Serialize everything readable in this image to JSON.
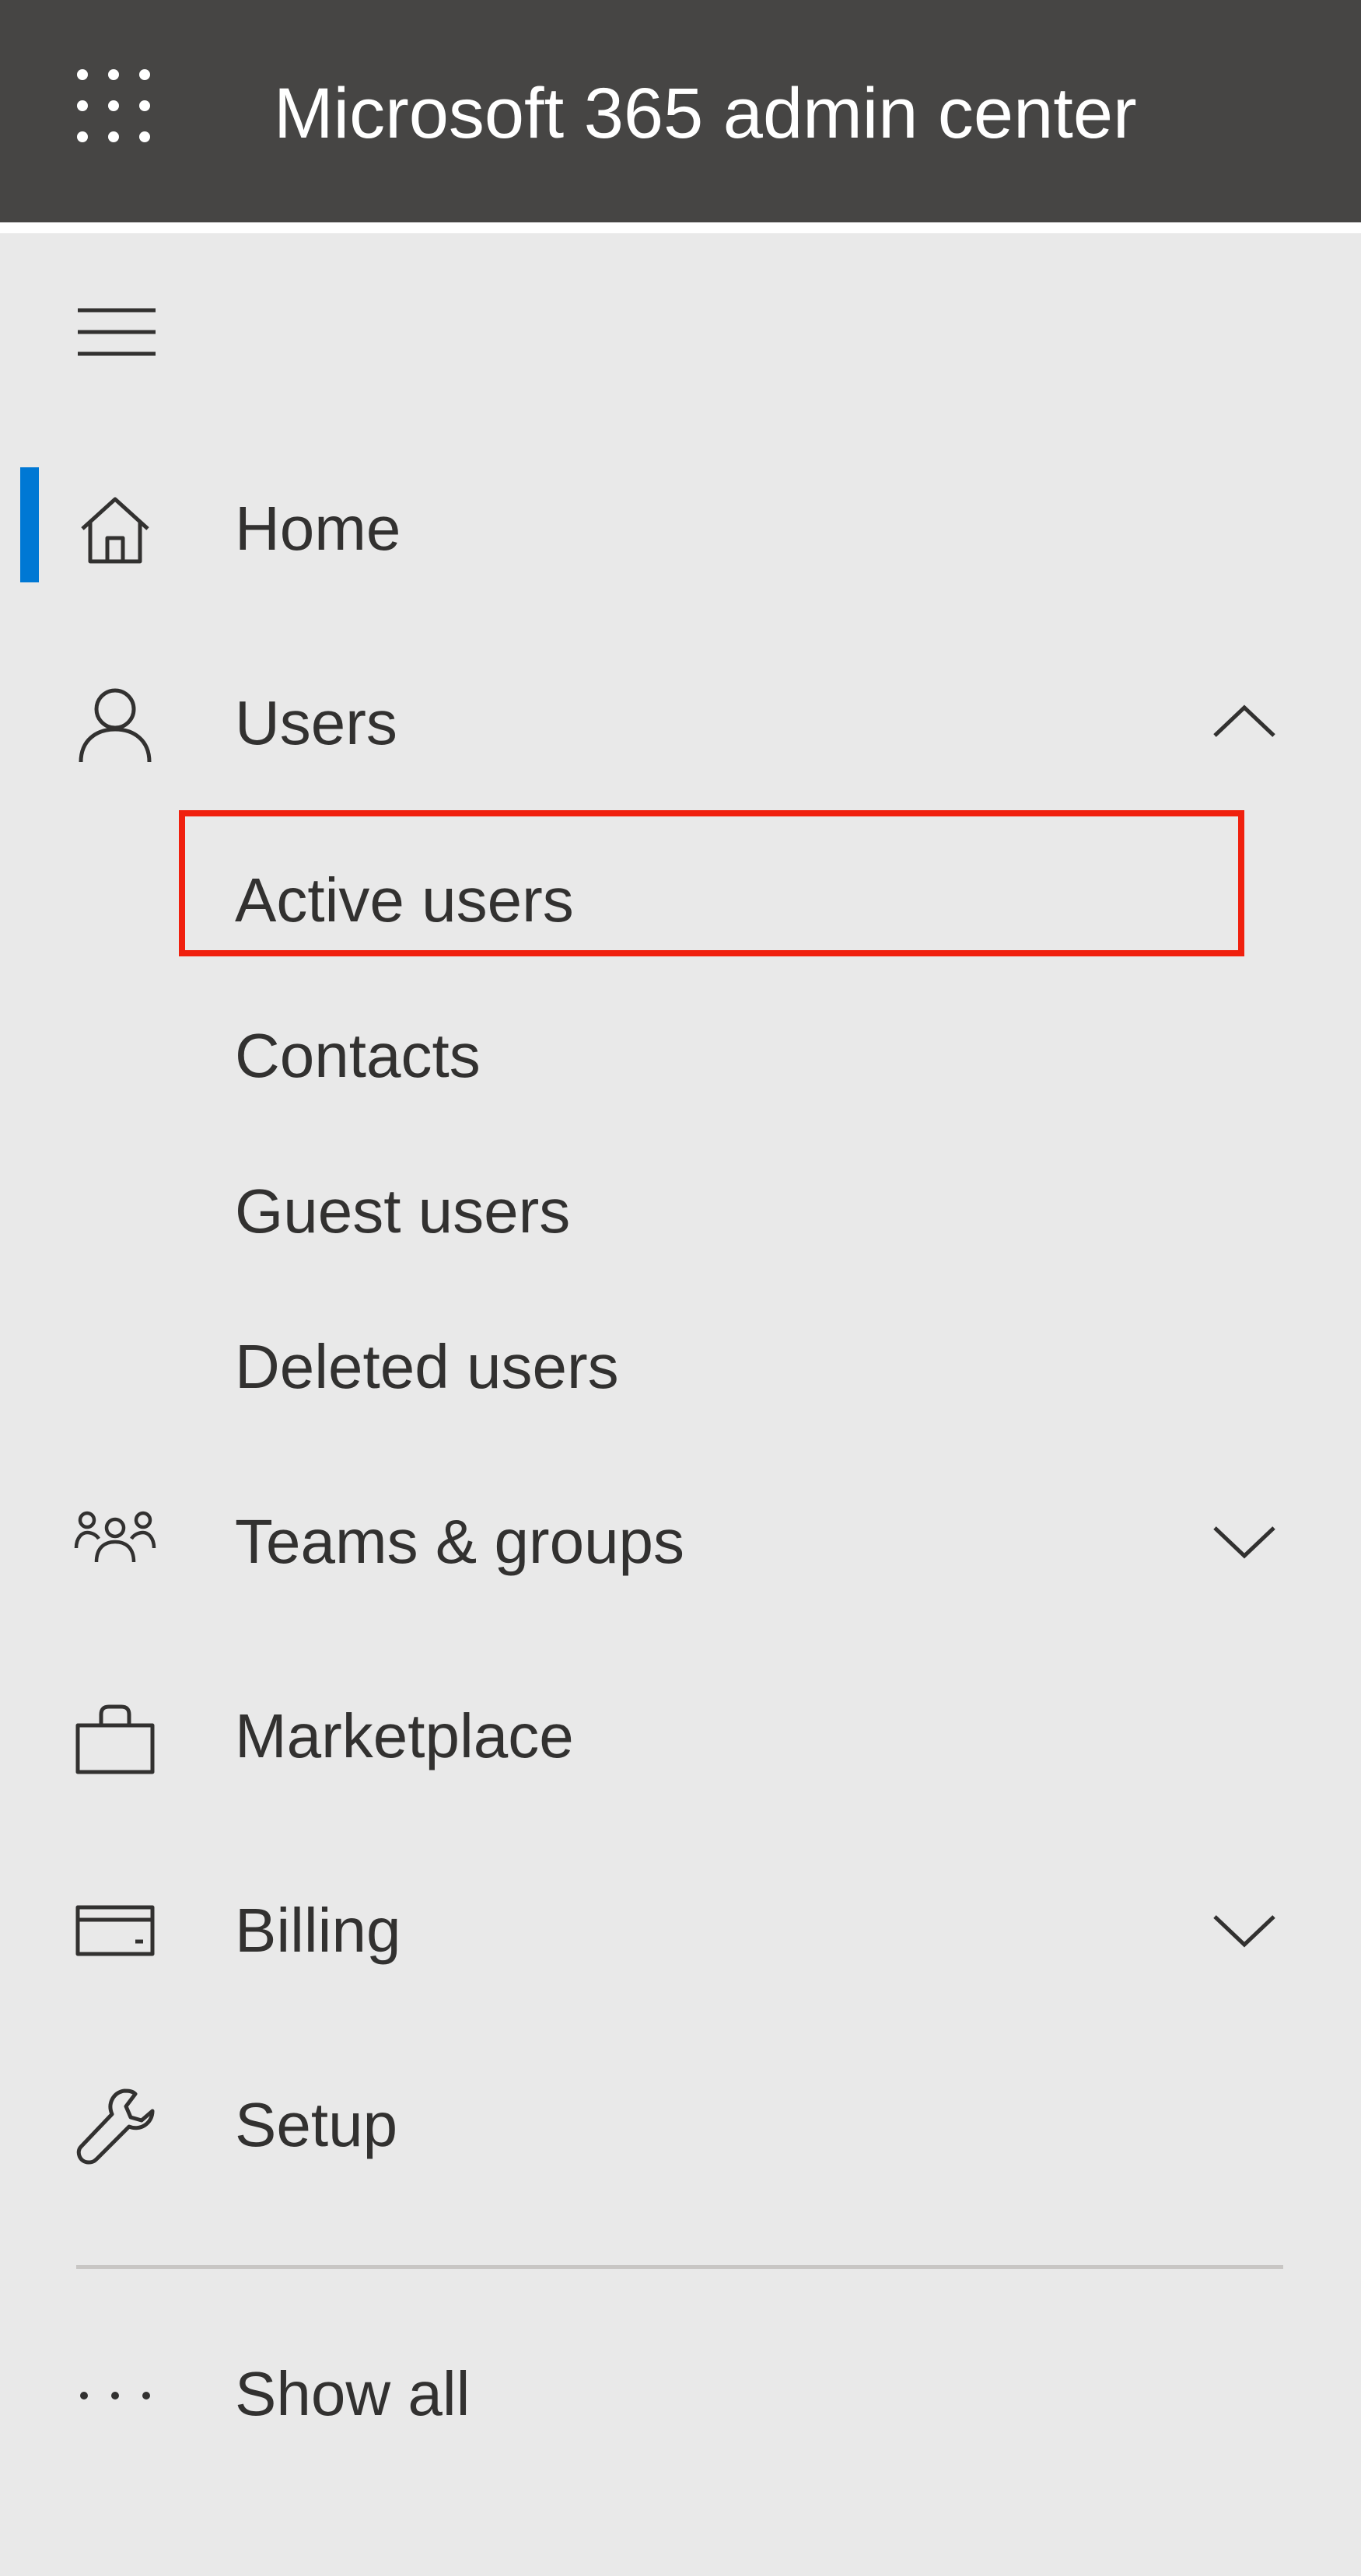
{
  "header": {
    "app_title": "Microsoft 365 admin center",
    "launcher_icon": "waffle-icon"
  },
  "nav": {
    "menu_icon": "hamburger-icon",
    "accent_color": "#0078d4",
    "items": [
      {
        "id": "home",
        "label": "Home",
        "icon": "home-icon",
        "selected": true
      },
      {
        "id": "users",
        "label": "Users",
        "icon": "person-icon",
        "expanded": true,
        "children": [
          {
            "id": "active-users",
            "label": "Active users",
            "highlighted": true
          },
          {
            "id": "contacts",
            "label": "Contacts"
          },
          {
            "id": "guest-users",
            "label": "Guest users"
          },
          {
            "id": "deleted-users",
            "label": "Deleted users"
          }
        ]
      },
      {
        "id": "teams-groups",
        "label": "Teams & groups",
        "icon": "people-group-icon",
        "expanded": false
      },
      {
        "id": "marketplace",
        "label": "Marketplace",
        "icon": "shopping-bag-icon"
      },
      {
        "id": "billing",
        "label": "Billing",
        "icon": "credit-card-icon",
        "expanded": false
      },
      {
        "id": "setup",
        "label": "Setup",
        "icon": "wrench-icon"
      }
    ],
    "show_all": {
      "label": "Show all",
      "icon": "more-dots-icon"
    }
  },
  "annotation": {
    "highlight_color": "#f0200e"
  }
}
